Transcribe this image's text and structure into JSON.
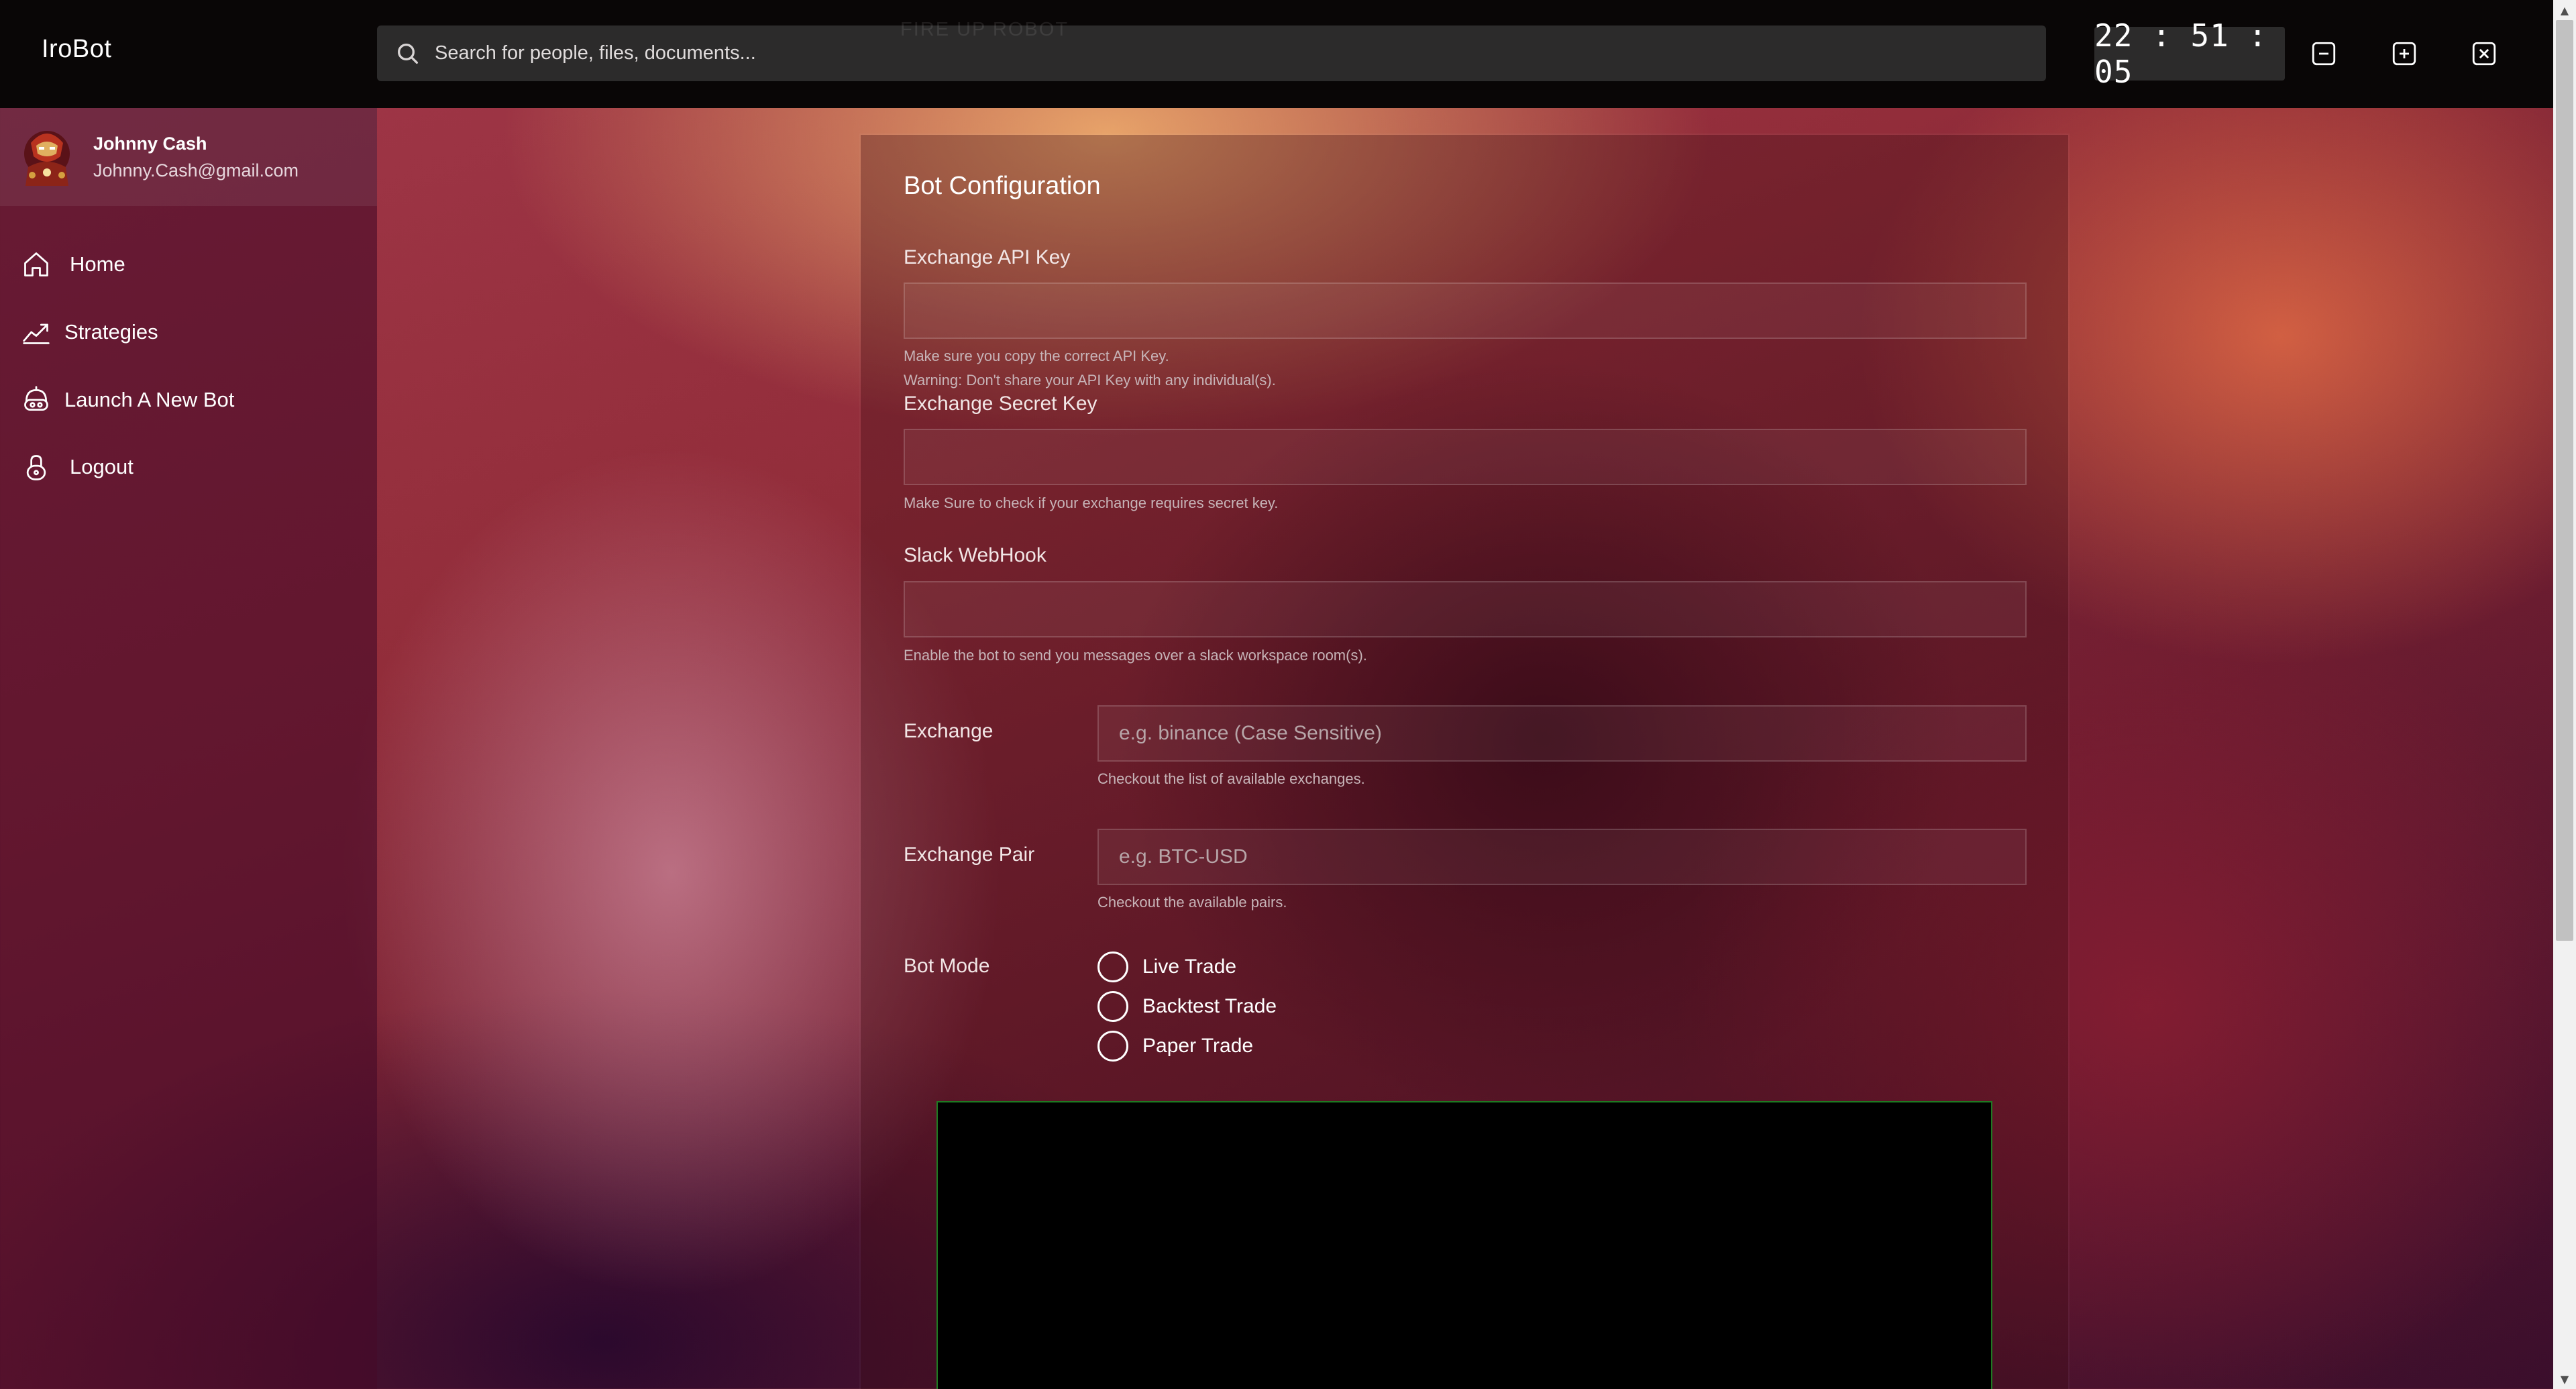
{
  "app": {
    "title": "IroBot"
  },
  "header": {
    "search_placeholder": "Search for people, files, documents...",
    "ghost_heading": "FIRE UP ROBOT",
    "clock": "22 : 51 : 05"
  },
  "user": {
    "name": "Johnny Cash",
    "email": "Johnny.Cash@gmail.com"
  },
  "sidebar": {
    "items": [
      {
        "label": "Home",
        "icon": "home-icon"
      },
      {
        "label": "Strategies",
        "icon": "chart-line-icon"
      },
      {
        "label": "Launch A New Bot",
        "icon": "robot-icon"
      },
      {
        "label": "Logout",
        "icon": "lock-icon"
      }
    ]
  },
  "form": {
    "title": "Bot Configuration",
    "api_key": {
      "label": "Exchange API Key",
      "value": "",
      "hint1": "Make sure you copy the correct API Key.",
      "hint2": "Warning: Don't share your API Key with any individual(s)."
    },
    "secret_key": {
      "label": "Exchange Secret Key",
      "value": "",
      "hint": "Make Sure to check if your exchange requires secret key."
    },
    "slack": {
      "label": "Slack WebHook",
      "value": "",
      "hint": "Enable the bot to send you messages over a slack workspace room(s)."
    },
    "exchange": {
      "label": "Exchange",
      "placeholder": "e.g. binance (Case Sensitive)",
      "hint": "Checkout the list of available exchanges."
    },
    "pair": {
      "label": "Exchange Pair",
      "placeholder": "e.g. BTC-USD",
      "hint": "Checkout the available pairs."
    },
    "bot_mode": {
      "label": "Bot Mode",
      "options": [
        "Live Trade",
        "Backtest Trade",
        "Paper Trade"
      ],
      "selected": null
    }
  },
  "colors": {
    "topbar": "#090606",
    "console_border": "#1e7a22",
    "accent_text": "#ffffff"
  }
}
